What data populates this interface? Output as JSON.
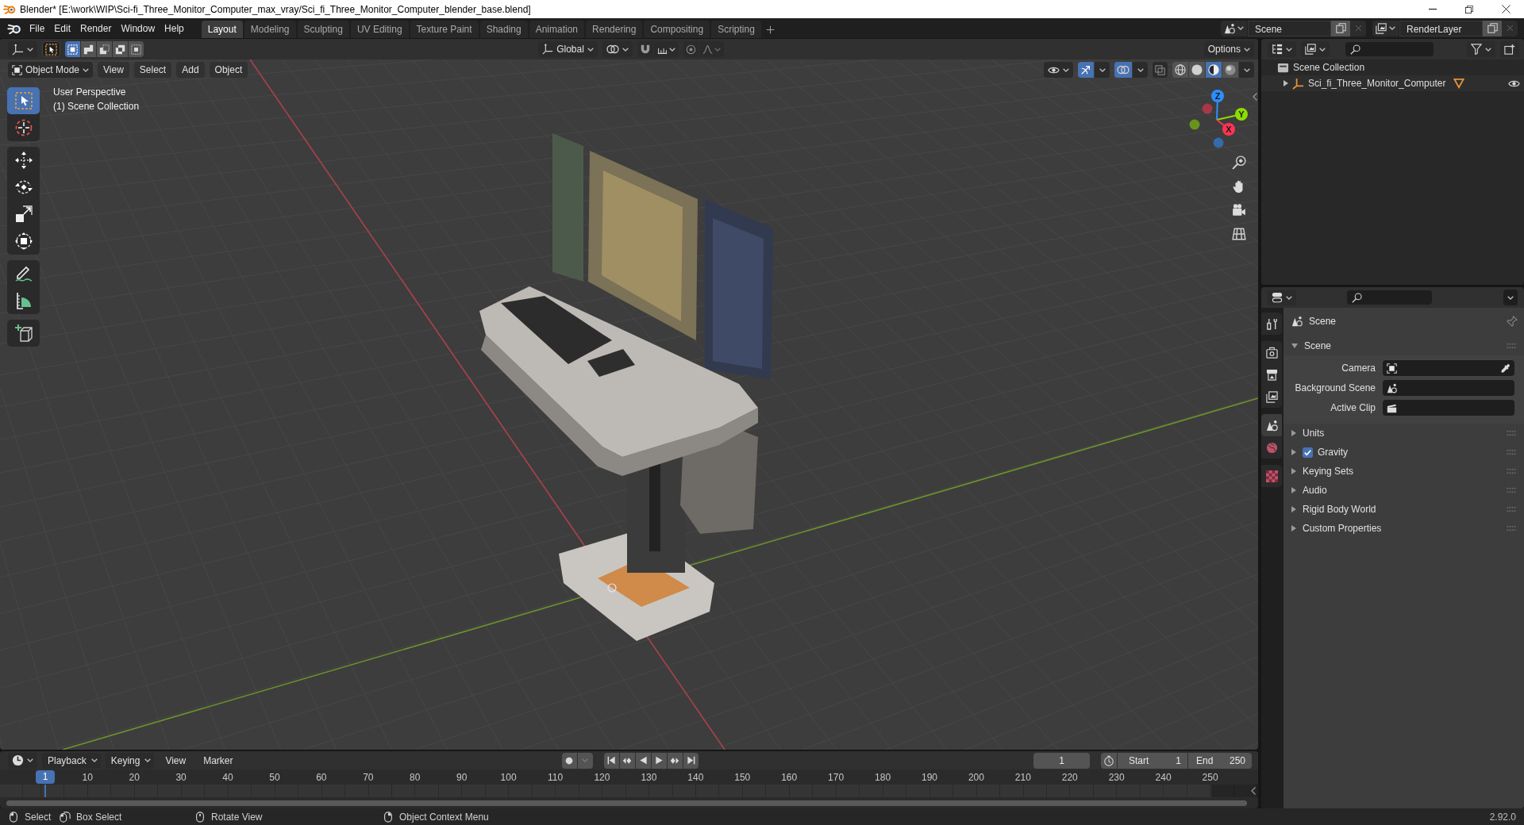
{
  "window": {
    "title": "Blender* [E:\\work\\WIP\\Sci-fi_Three_Monitor_Computer_max_vray/Sci_fi_Three_Monitor_Computer_blender_base.blend]"
  },
  "top_bar": {
    "menus": [
      "File",
      "Edit",
      "Render",
      "Window",
      "Help"
    ],
    "workspaces": [
      {
        "label": "Layout",
        "selected": true
      },
      {
        "label": "Modeling",
        "selected": false
      },
      {
        "label": "Sculpting",
        "selected": false
      },
      {
        "label": "UV Editing",
        "selected": false
      },
      {
        "label": "Texture Paint",
        "selected": false
      },
      {
        "label": "Shading",
        "selected": false
      },
      {
        "label": "Animation",
        "selected": false
      },
      {
        "label": "Rendering",
        "selected": false
      },
      {
        "label": "Compositing",
        "selected": false
      },
      {
        "label": "Scripting",
        "selected": false
      }
    ],
    "scene": "Scene",
    "view_layer": "RenderLayer"
  },
  "viewport": {
    "tool_header": {
      "select_modes": [
        {
          "kind": "set",
          "selected": true
        },
        {
          "kind": "extend",
          "selected": false
        },
        {
          "kind": "subtract",
          "selected": false
        },
        {
          "kind": "invert",
          "selected": false
        },
        {
          "kind": "intersect",
          "selected": false
        }
      ],
      "orientation": "Global",
      "snap": false,
      "proportional": false,
      "options": "Options"
    },
    "header": {
      "mode": "Object Mode",
      "menus": [
        "View",
        "Select",
        "Add",
        "Object"
      ],
      "gizmos": true,
      "overlays": true,
      "xray": false,
      "shading": [
        {
          "kind": "wireframe",
          "selected": false
        },
        {
          "kind": "solid",
          "selected": false
        },
        {
          "kind": "material",
          "selected": true
        },
        {
          "kind": "rendered",
          "selected": false
        }
      ]
    },
    "tool_groups": [
      {
        "tools": [
          {
            "kind": "select_box",
            "selected": true
          },
          {
            "kind": "cursor",
            "selected": false
          }
        ]
      },
      {
        "tools": [
          {
            "kind": "move",
            "selected": false
          },
          {
            "kind": "rotate",
            "selected": false
          },
          {
            "kind": "scale",
            "selected": false
          },
          {
            "kind": "transform",
            "selected": false
          }
        ]
      },
      {
        "tools": [
          {
            "kind": "annotate",
            "selected": false
          },
          {
            "kind": "measure",
            "selected": false
          }
        ]
      },
      {
        "tools": [
          {
            "kind": "add_cube",
            "selected": false
          }
        ]
      }
    ],
    "info": [
      "User Perspective",
      "(1) Scene Collection"
    ],
    "gizmo": [
      {
        "label": "Z",
        "color": "#2c8fff"
      },
      {
        "label": "Y",
        "color": "#8bdc00"
      },
      {
        "label": "X",
        "color": "#ff3352"
      }
    ]
  },
  "outliner": {
    "tree": [
      {
        "label": "Scene Collection",
        "kind": "collection",
        "children": [
          {
            "label": "Sci_fi_Three_Monitor_Computer",
            "kind": "empty",
            "expanded": false,
            "visible": true
          }
        ]
      }
    ]
  },
  "properties": {
    "tab_groups": [
      {
        "tabs": [
          {
            "kind": "tool",
            "selected": false
          }
        ]
      },
      {
        "tabs": [
          {
            "kind": "render",
            "selected": false
          },
          {
            "kind": "output",
            "selected": false
          },
          {
            "kind": "view_layer",
            "selected": false
          }
        ]
      },
      {
        "tabs": [
          {
            "kind": "scene",
            "selected": true
          },
          {
            "kind": "world",
            "selected": false
          }
        ]
      },
      {
        "tabs": [
          {
            "kind": "texture",
            "selected": false
          }
        ]
      }
    ],
    "context": "Scene",
    "panels": [
      {
        "label": "Scene",
        "expanded": true,
        "fields": [
          {
            "label": "Camera",
            "kind": "object"
          },
          {
            "label": "Background Scene",
            "kind": "scene"
          },
          {
            "label": "Active Clip",
            "kind": "clip"
          }
        ]
      },
      {
        "label": "Units",
        "expanded": false
      },
      {
        "label": "Gravity",
        "expanded": false,
        "checked": true
      },
      {
        "label": "Keying Sets",
        "expanded": false
      },
      {
        "label": "Audio",
        "expanded": false
      },
      {
        "label": "Rigid Body World",
        "expanded": false
      },
      {
        "label": "Custom Properties",
        "expanded": false
      }
    ]
  },
  "timeline": {
    "menus": [
      {
        "label": "Playback",
        "kind": "dropdown"
      },
      {
        "label": "Keying",
        "kind": "dropdown"
      },
      {
        "label": "View",
        "kind": "menu"
      },
      {
        "label": "Marker",
        "kind": "menu"
      }
    ],
    "current_frame": "1",
    "start": {
      "label": "Start",
      "value": "1"
    },
    "end": {
      "label": "End",
      "value": "250"
    },
    "playhead": "1",
    "ticks": [
      "10",
      "20",
      "30",
      "40",
      "50",
      "60",
      "70",
      "80",
      "90",
      "100",
      "110",
      "120",
      "130",
      "140",
      "150",
      "160",
      "170",
      "180",
      "190",
      "200",
      "210",
      "220",
      "230",
      "240",
      "250"
    ]
  },
  "status_bar": {
    "hints": [
      {
        "label": "Select",
        "kind": "left"
      },
      {
        "label": "Box Select",
        "kind": "drag"
      },
      {
        "label": "Rotate View",
        "kind": "middle"
      },
      {
        "label": "Object Context Menu",
        "kind": "right"
      }
    ],
    "version": "2.92.0"
  }
}
